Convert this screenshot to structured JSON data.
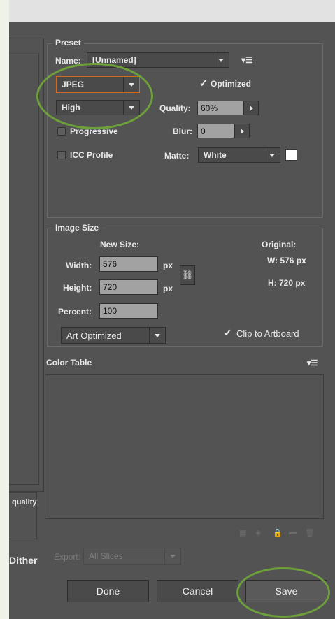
{
  "preset": {
    "legend": "Preset",
    "name_label": "Name:",
    "name_value": "[Unnamed]",
    "format_value": "JPEG",
    "quality_preset_value": "High",
    "optimized_label": "Optimized",
    "optimized_checked": true,
    "quality_label": "Quality:",
    "quality_value": "60%",
    "progressive_label": "Progressive",
    "progressive_checked": false,
    "blur_label": "Blur:",
    "blur_value": "0",
    "icc_label": "ICC Profile",
    "icc_checked": false,
    "matte_label": "Matte:",
    "matte_value": "White",
    "matte_swatch_color": "#ffffff",
    "menu_icon": "flyout-menu-icon"
  },
  "image_size": {
    "legend": "Image Size",
    "new_size_label": "New Size:",
    "width_label": "Width:",
    "width_value": "576",
    "height_label": "Height:",
    "height_value": "720",
    "percent_label": "Percent:",
    "percent_value": "100",
    "unit": "px",
    "original_label": "Original:",
    "original_w": "W:  576 px",
    "original_h": "H:  720 px",
    "resample_value": "Art Optimized",
    "clip_label": "Clip to Artboard",
    "clip_checked": true,
    "link_icon": "chain-link-icon"
  },
  "color_table": {
    "title": "Color Table",
    "menu_icon": "flyout-menu-icon"
  },
  "left_panel": {
    "quality_fragment": "quality",
    "dither_fragment": "Dither"
  },
  "export": {
    "label": "Export:",
    "value": "All Slices"
  },
  "buttons": {
    "done": "Done",
    "cancel": "Cancel",
    "save": "Save"
  },
  "annotation_color": "#6da03a",
  "glyphs": {
    "check": "✓",
    "menu": "▾☰",
    "link": "⛓"
  }
}
